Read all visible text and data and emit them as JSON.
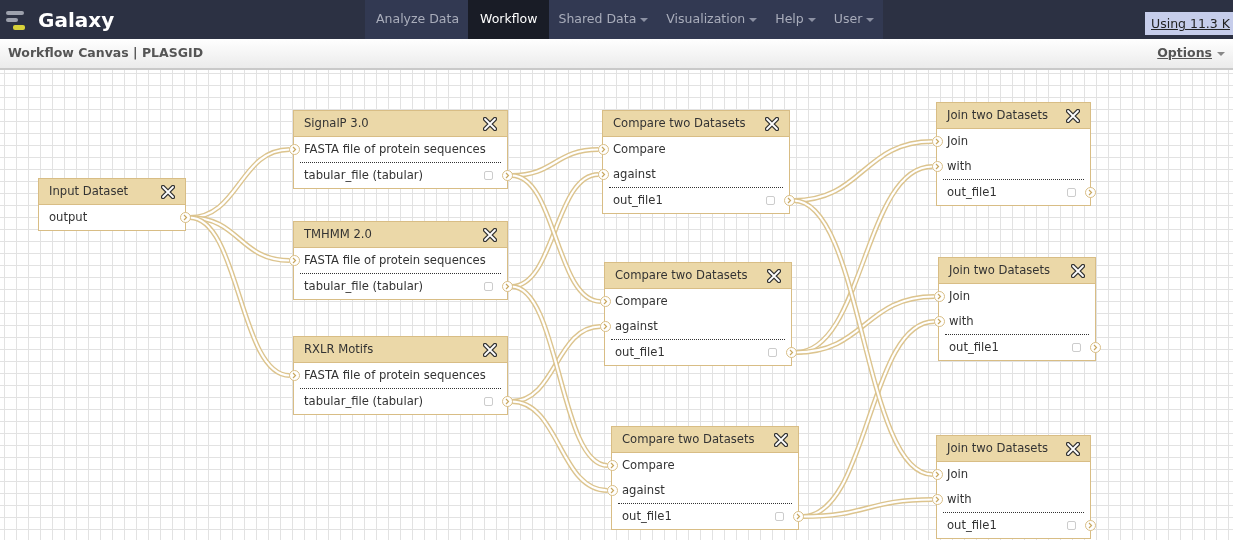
{
  "navbar": {
    "brand": "Galaxy",
    "menu": [
      {
        "label": "Analyze Data",
        "selected": false,
        "dropdown": false
      },
      {
        "label": "Workflow",
        "selected": true,
        "dropdown": false
      },
      {
        "label": "Shared Data",
        "selected": false,
        "dropdown": true
      },
      {
        "label": "Visualization",
        "selected": false,
        "dropdown": true
      },
      {
        "label": "Help",
        "selected": false,
        "dropdown": true
      },
      {
        "label": "User",
        "selected": false,
        "dropdown": true
      }
    ],
    "usage": "Using 11.3 K"
  },
  "header": {
    "title": "Workflow Canvas | PLASGID",
    "options": "Options"
  },
  "nodes": [
    {
      "title": "Input Dataset",
      "outputs": [
        {
          "label": "output"
        }
      ]
    },
    {
      "title": "SignalP 3.0",
      "inputs": [
        "FASTA file of protein sequences"
      ],
      "outputs": [
        {
          "label": "tabular_file (tabular)",
          "checked": false
        }
      ]
    },
    {
      "title": "TMHMM 2.0",
      "inputs": [
        "FASTA file of protein sequences"
      ],
      "outputs": [
        {
          "label": "tabular_file (tabular)",
          "checked": false
        }
      ]
    },
    {
      "title": "RXLR Motifs",
      "inputs": [
        "FASTA file of protein sequences"
      ],
      "outputs": [
        {
          "label": "tabular_file (tabular)",
          "checked": false
        }
      ]
    },
    {
      "title": "Compare two Datasets",
      "inputs": [
        "Compare",
        "against"
      ],
      "outputs": [
        {
          "label": "out_file1",
          "checked": false
        }
      ]
    },
    {
      "title": "Compare two Datasets",
      "inputs": [
        "Compare",
        "against"
      ],
      "outputs": [
        {
          "label": "out_file1",
          "checked": false
        }
      ]
    },
    {
      "title": "Compare two Datasets",
      "inputs": [
        "Compare",
        "against"
      ],
      "outputs": [
        {
          "label": "out_file1",
          "checked": false
        }
      ]
    },
    {
      "title": "Join two Datasets",
      "inputs": [
        "Join",
        "with"
      ],
      "outputs": [
        {
          "label": "out_file1",
          "checked": false
        }
      ]
    },
    {
      "title": "Join two Datasets",
      "inputs": [
        "Join",
        "with"
      ],
      "outputs": [
        {
          "label": "out_file1",
          "checked": false
        }
      ]
    },
    {
      "title": "Join two Datasets",
      "inputs": [
        "Join",
        "with"
      ],
      "outputs": [
        {
          "label": "out_file1",
          "checked": false
        }
      ]
    }
  ]
}
